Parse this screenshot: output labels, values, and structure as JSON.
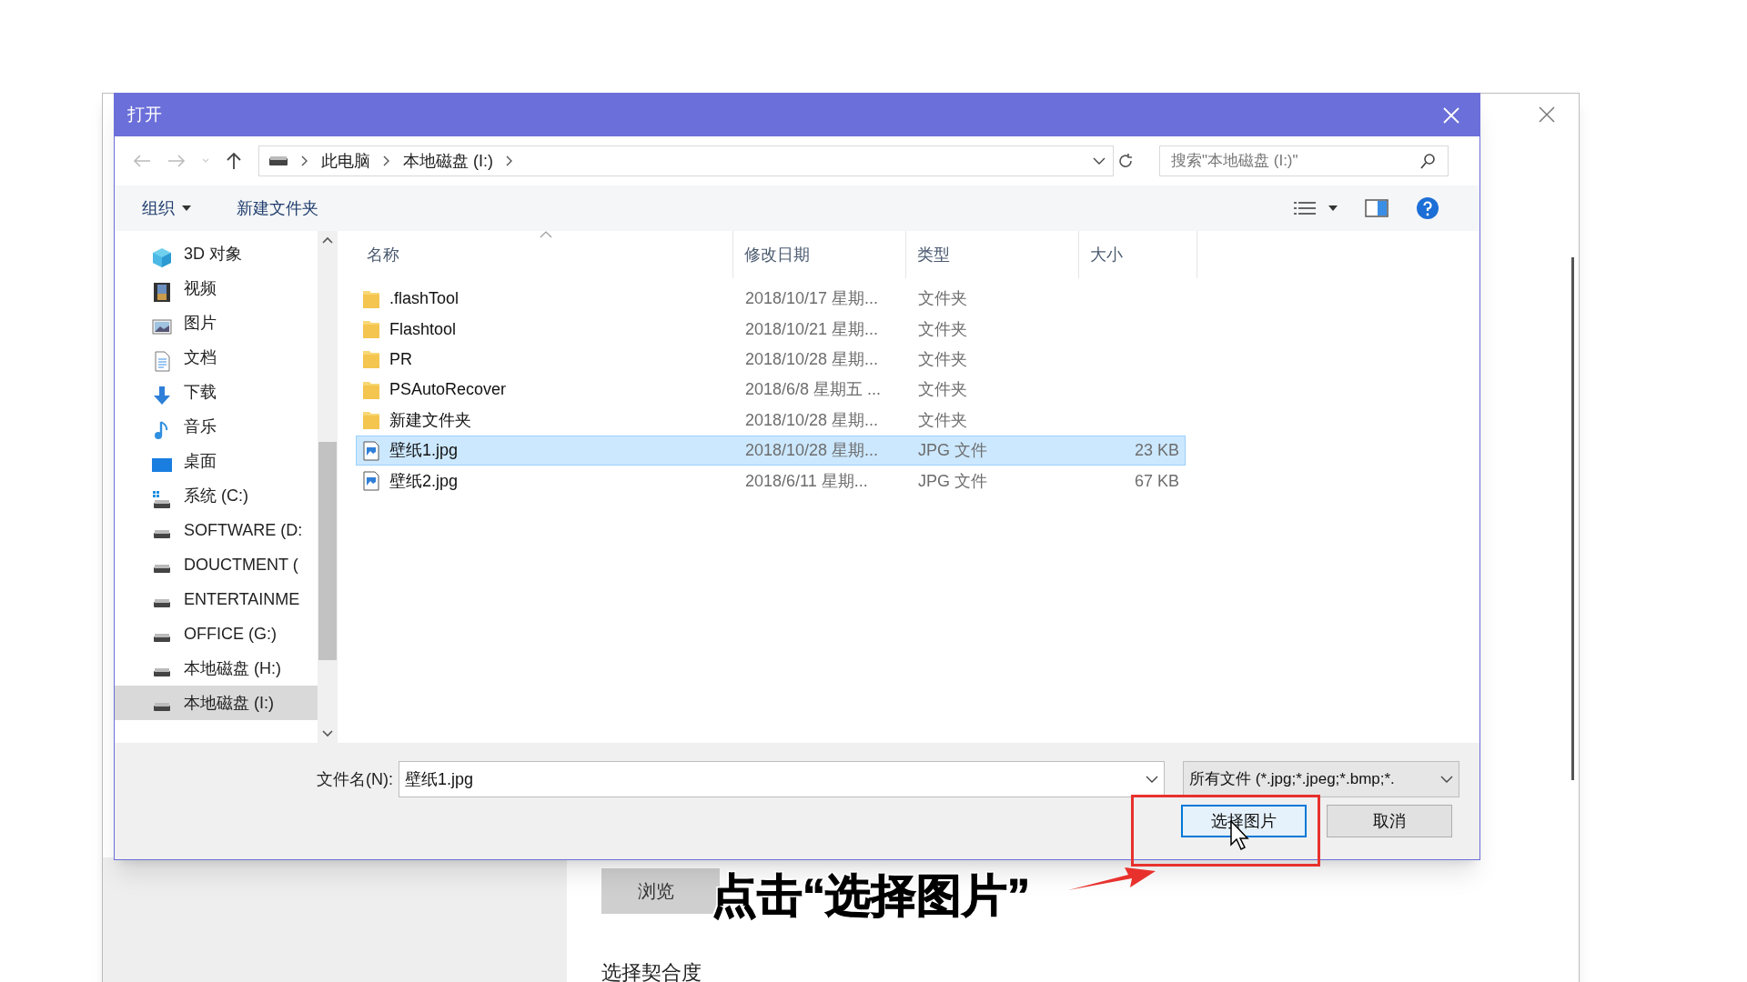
{
  "background_window": {
    "browse_button": "浏览",
    "section_label": "选择契合度"
  },
  "dialog": {
    "title": "打开",
    "breadcrumb": [
      "此电脑",
      "本地磁盘 (I:)"
    ],
    "search": {
      "placeholder": "搜索\"本地磁盘 (I:)\""
    },
    "toolbar": [
      {
        "label": "组织",
        "dropdown": true
      },
      {
        "label": "新建文件夹",
        "dropdown": false
      }
    ],
    "nav_items": [
      {
        "label": "3D 对象",
        "kind": "objects3d",
        "selected": false
      },
      {
        "label": "视频",
        "kind": "video",
        "selected": false
      },
      {
        "label": "图片",
        "kind": "pictures",
        "selected": false
      },
      {
        "label": "文档",
        "kind": "documents",
        "selected": false
      },
      {
        "label": "下载",
        "kind": "downloads",
        "selected": false
      },
      {
        "label": "音乐",
        "kind": "music",
        "selected": false
      },
      {
        "label": "桌面",
        "kind": "desktop",
        "selected": false
      },
      {
        "label": "系统 (C:)",
        "kind": "system",
        "selected": false
      },
      {
        "label": "SOFTWARE (D:",
        "kind": "drive",
        "selected": false
      },
      {
        "label": "DOUCTMENT (",
        "kind": "drive",
        "selected": false
      },
      {
        "label": "ENTERTAINME",
        "kind": "drive",
        "selected": false
      },
      {
        "label": "OFFICE (G:)",
        "kind": "drive",
        "selected": false
      },
      {
        "label": "本地磁盘 (H:)",
        "kind": "drive",
        "selected": false
      },
      {
        "label": "本地磁盘 (I:)",
        "kind": "drive",
        "selected": true
      }
    ],
    "columns": [
      "名称",
      "修改日期",
      "类型",
      "大小"
    ],
    "files": [
      {
        "kind": "folder",
        "name": ".flashTool",
        "date": "2018/10/17 星期...",
        "type": "文件夹",
        "selected": false
      },
      {
        "kind": "folder",
        "name": "Flashtool",
        "date": "2018/10/21 星期...",
        "type": "文件夹",
        "selected": false
      },
      {
        "kind": "folder",
        "name": "PR",
        "date": "2018/10/28 星期...",
        "type": "文件夹",
        "selected": false
      },
      {
        "kind": "folder",
        "name": "PSAutoRecover",
        "date": "2018/6/8 星期五 ...",
        "type": "文件夹",
        "selected": false
      },
      {
        "kind": "folder",
        "name": "新建文件夹",
        "date": "2018/10/28 星期...",
        "type": "文件夹",
        "selected": false
      },
      {
        "kind": "image",
        "name": "壁纸1.jpg",
        "date": "2018/10/28 星期...",
        "type": "JPG 文件",
        "size": "23 KB",
        "selected": true
      },
      {
        "kind": "image",
        "name": "壁纸2.jpg",
        "date": "2018/6/11 星期...",
        "type": "JPG 文件",
        "size": "67 KB",
        "selected": false
      }
    ],
    "filename_label": "文件名(N):",
    "filename_value": "壁纸1.jpg",
    "filter": "所有文件 (*.jpg;*.jpeg;*.bmp;*.",
    "buttons": [
      {
        "label": "选择图片",
        "kind": "primary"
      },
      {
        "label": "取消",
        "kind": "default"
      }
    ]
  },
  "annotation": {
    "caption": "点击“选择图片”"
  }
}
